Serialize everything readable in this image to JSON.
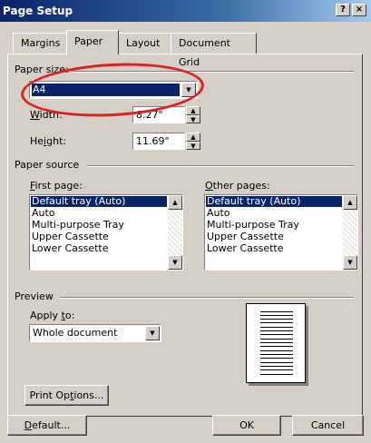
{
  "window": {
    "title": "Page Setup",
    "help_button": "?",
    "close_button": "×"
  },
  "tabs": [
    "Margins",
    "Paper",
    "Layout",
    "Document Grid"
  ],
  "active_tab": "Paper",
  "paper_size": {
    "section_label": "Paper size:",
    "selected": "A4",
    "width_label": "Width:",
    "width_value": "8.27\"",
    "height_label": "Height:",
    "height_value": "11.69\""
  },
  "paper_source": {
    "section_label": "Paper source",
    "first_page_label": "First page:",
    "other_pages_label": "Other pages:",
    "items": [
      "Default tray (Auto)",
      "Auto",
      "Multi-purpose Tray",
      "Upper Cassette",
      "Lower Cassette"
    ],
    "first_page_selected": "Default tray (Auto)",
    "other_pages_selected": "Default tray (Auto)"
  },
  "preview": {
    "section_label": "Preview",
    "apply_to_label": "Apply to:",
    "apply_to_value": "Whole document"
  },
  "buttons": {
    "print_options": "Print Options...",
    "default": "Default...",
    "ok": "OK",
    "cancel": "Cancel"
  },
  "icons": {
    "dropdown": "chevron-down-icon",
    "spin_up": "arrow-up-icon",
    "spin_down": "arrow-down-icon",
    "scroll_up": "scroll-up-icon",
    "scroll_down": "scroll-down-icon"
  },
  "colors": {
    "title_gradient_start": "#0a246a",
    "selection": "#0a246a",
    "dialog_bg": "#d4d0c8",
    "annotation_ring": "#e02020"
  }
}
